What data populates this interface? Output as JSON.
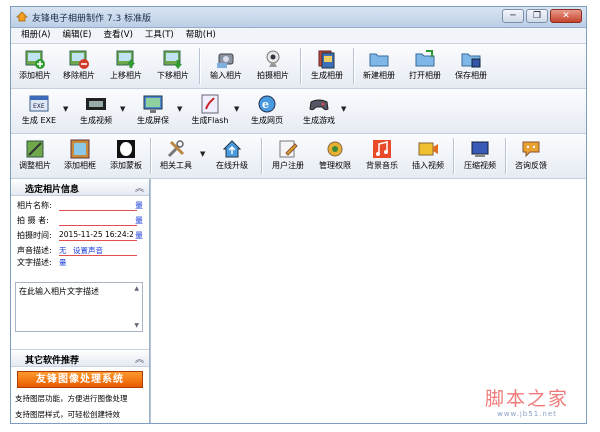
{
  "window": {
    "title": "友锋电子相册制作 7.3 标准版"
  },
  "titlebar_buttons": {
    "minimize": "─",
    "restore": "❐",
    "close": "✕"
  },
  "menu": [
    "相册(A)",
    "编辑(E)",
    "查看(V)",
    "工具(T)",
    "帮助(H)"
  ],
  "toolbar1": {
    "add_photo": "添加相片",
    "remove_photo": "移除相片",
    "move_up": "上移相片",
    "move_down": "下移相片",
    "import_photo": "输入相片",
    "take_photo": "拍摄相片",
    "generate_album": "生成相册",
    "new_album": "新建相册",
    "open_album": "打开相册",
    "save_album": "保存相册"
  },
  "toolbar2": {
    "gen_exe": "生成 EXE",
    "gen_video": "生成视频",
    "gen_screensaver": "生成屏保",
    "gen_flash": "生成Flash",
    "gen_webpage": "生成网页",
    "gen_game": "生成游戏"
  },
  "toolbar3": {
    "adjust_photo": "调整相片",
    "add_frame": "添加相框",
    "add_mask": "添加蒙板",
    "related_tools": "相关工具",
    "online_upgrade": "在线升级",
    "user_register": "用户注册",
    "manage_rights": "管理权限",
    "bg_music": "背景音乐",
    "insert_video": "插入视频",
    "compress_video": "压缩视频",
    "feedback": "咨询反馈"
  },
  "photo_info": {
    "header": "选定相片信息",
    "name_label": "相片名称:",
    "photographer_label": "拍 摄 者:",
    "time_label": "拍摄时间:",
    "time_value": "2015-11-25 16:24:2",
    "sound_label": "声音描述:",
    "sound_value": "无",
    "set_sound": "设置声音",
    "text_label": "文字描述:",
    "edit_btn": "量",
    "text_placeholder": "在此输入相片文字描述"
  },
  "other_software": {
    "header": "其它软件推荐",
    "banner": "友锋图像处理系统",
    "line1": "支持图层功能，方便进行图像处理",
    "line2": "支持图层样式，可轻松创建特效"
  },
  "watermark": {
    "main": "脚本之家",
    "sub": "www.jb51.net"
  },
  "colors": {
    "accent_red": "#e05050",
    "link_blue": "#1a3fd8",
    "banner_orange": "#ff9a2e"
  }
}
